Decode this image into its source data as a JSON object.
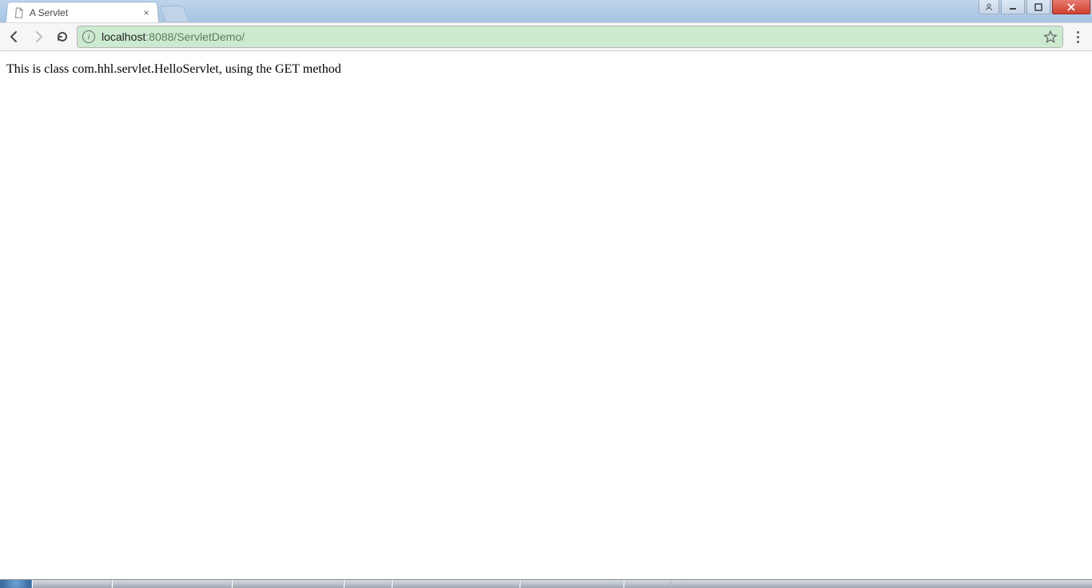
{
  "window": {
    "controls": {
      "user": "user",
      "minimize": "minimize",
      "maximize": "maximize",
      "close": "close"
    }
  },
  "tabs": {
    "active": {
      "title": "A Servlet"
    }
  },
  "toolbar": {
    "back": "Back",
    "forward": "Forward",
    "reload": "Reload",
    "menu": "Menu",
    "bookmark": "Bookmark this page"
  },
  "address": {
    "site_info_label": "i",
    "host": "localhost",
    "port_path": ":8088/ServletDemo/",
    "full": "localhost:8088/ServletDemo/"
  },
  "page": {
    "body_text": "This is class com.hhl.servlet.HelloServlet, using the GET method"
  }
}
